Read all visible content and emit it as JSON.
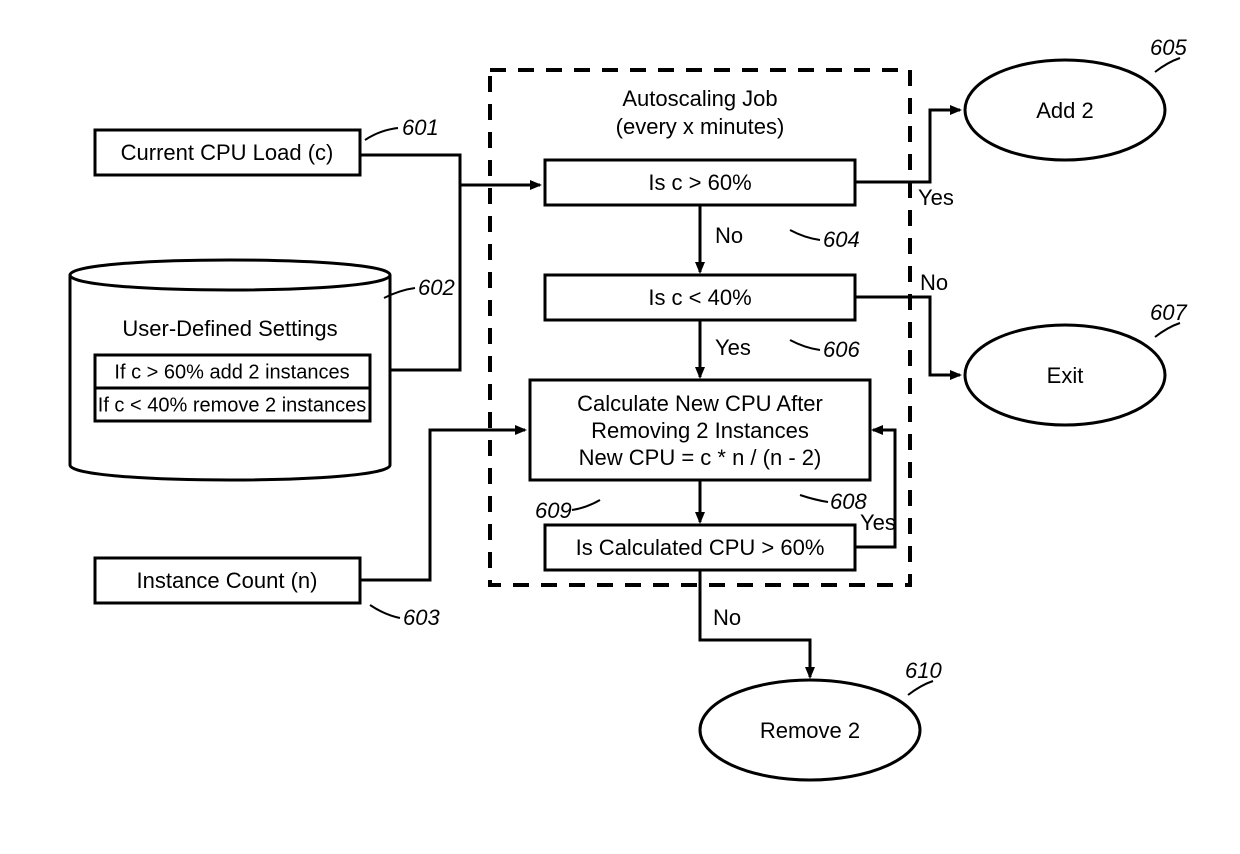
{
  "inputs": {
    "cpu_load": {
      "label": "Current CPU Load (c)",
      "ref": "601"
    },
    "settings": {
      "title": "User-Defined Settings",
      "rule1": "If c > 60% add 2 instances",
      "rule2": "If c < 40% remove 2 instances",
      "ref": "602"
    },
    "instance_count": {
      "label": "Instance Count (n)",
      "ref": "603"
    }
  },
  "job": {
    "title1": "Autoscaling Job",
    "title2": "(every x minutes)",
    "decision1": {
      "label": "Is c > 60%",
      "ref": "604",
      "yes": "Yes",
      "no": "No"
    },
    "decision2": {
      "label": "Is c < 40%",
      "ref": "606",
      "yes": "Yes",
      "no": "No"
    },
    "calc": {
      "line1": "Calculate New CPU After",
      "line2": "Removing 2 Instances",
      "line3": "New CPU = c * n / (n - 2)",
      "ref": "608"
    },
    "decision3": {
      "label": "Is Calculated CPU > 60%",
      "ref": "609",
      "yes": "Yes",
      "no": "No"
    }
  },
  "outcomes": {
    "add": {
      "label": "Add 2",
      "ref": "605"
    },
    "exit": {
      "label": "Exit",
      "ref": "607"
    },
    "remove": {
      "label": "Remove 2",
      "ref": "610"
    }
  }
}
